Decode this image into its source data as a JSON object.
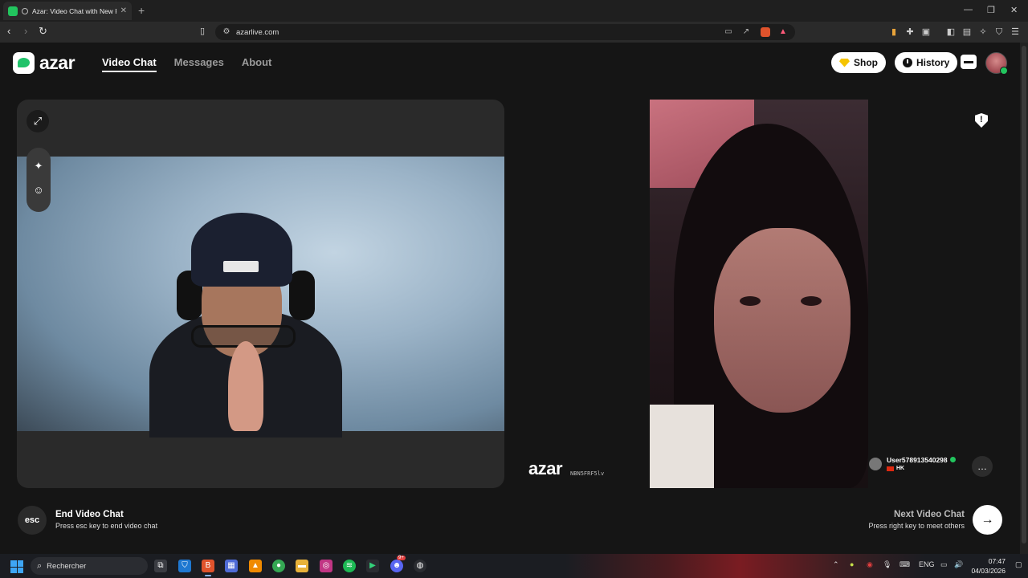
{
  "browser": {
    "tab_title": "Azar: Video Chat with New Pe",
    "url": "azarlive.com",
    "new_tab": "+",
    "win_minimize": "—",
    "win_restore": "❐",
    "win_close": "✕"
  },
  "header": {
    "logo_text": "azar",
    "nav": [
      {
        "label": "Video Chat",
        "active": true
      },
      {
        "label": "Messages",
        "active": false
      },
      {
        "label": "About",
        "active": false
      }
    ],
    "shop_label": "Shop",
    "history_label": "History"
  },
  "self_panel": {
    "expand_icon": "⤢",
    "effects_icon": "✦",
    "sticker_icon": "☺"
  },
  "remote": {
    "watermark": "azar",
    "watermark_code": "NBN5FRF5lv",
    "username": "User578913540298",
    "country": "HK",
    "chat_icon": "…"
  },
  "controls": {
    "esc_label": "esc",
    "end_title": "End Video Chat",
    "end_hint": "Press esc key to end video chat",
    "next_title": "Next Video Chat",
    "next_hint": "Press right key to meet others",
    "next_icon": "→"
  },
  "taskbar": {
    "search_placeholder": "Rechercher",
    "lang": "ENG",
    "time": "07:47",
    "date": "04/03/2026",
    "discord_badge": "9+"
  },
  "colors": {
    "accent": "#22c55e",
    "page_bg": "#151515",
    "shop_gem": "#f5c400"
  }
}
